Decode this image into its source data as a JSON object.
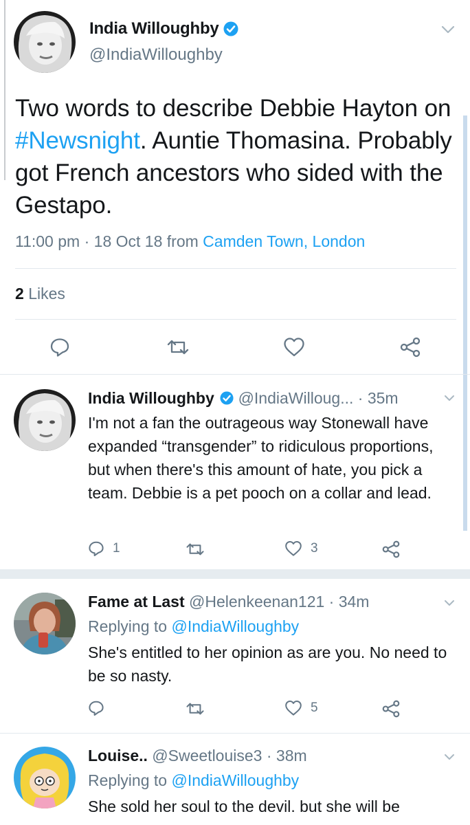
{
  "main_tweet": {
    "name": "India Willoughby",
    "handle": "@IndiaWilloughby",
    "text_before": "Two words to describe Debbie Hayton on ",
    "hashtag": "#Newsnight",
    "text_after": ". Auntie Thomasina. Probably got French ancestors who sided with the Gestapo.",
    "time": "11:00 pm",
    "dot": "·",
    "date": "18 Oct 18",
    "from_label": "from",
    "place": "Camden Town, London",
    "likes_count": "2",
    "likes_label": "Likes"
  },
  "replies": [
    {
      "name": "India Willoughby",
      "handle": "@IndiaWilloug...",
      "time": "· 35m",
      "text": "I'm not a fan the outrageous way Stonewall have expanded “transgender” to ridiculous proportions, but when there's this amount of hate, you pick a team. Debbie is a pet pooch on a collar and lead.",
      "reply_count": "1",
      "like_count": "3"
    },
    {
      "name": "Fame at Last",
      "handle": "@Helenkeenan121",
      "time": "· 34m",
      "replying_label": "Replying to",
      "replying_to": "@IndiaWilloughby",
      "text": "She's entitled to her opinion as are you. No need to be so nasty.",
      "like_count": "5"
    },
    {
      "name": "Louise..",
      "handle": "@Sweetlouise3",
      "time": "· 38m",
      "replying_label": "Replying to",
      "replying_to": "@IndiaWilloughby",
      "text": "She sold her soul to the devil. but she will be"
    }
  ],
  "colors": {
    "link": "#1da1f2",
    "secondary_text": "#657786",
    "divider": "#e1e8ed",
    "verified": "#1da1f2"
  },
  "icons": [
    "verified-badge-icon",
    "chevron-down-icon",
    "reply-icon",
    "retweet-icon",
    "like-icon",
    "share-icon"
  ]
}
